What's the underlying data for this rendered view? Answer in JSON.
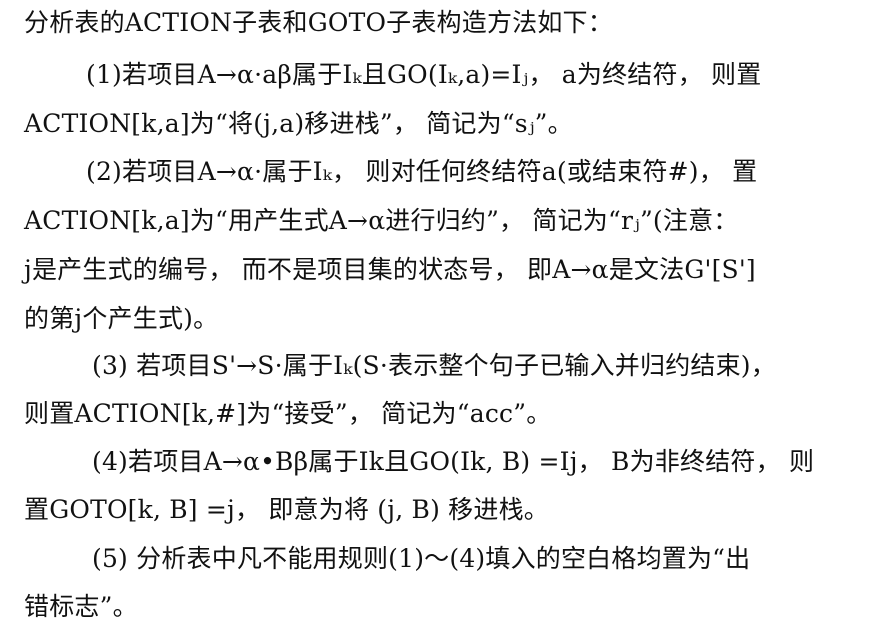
{
  "document": {
    "lines": [
      "分析表的ACTION子表和GOTO子表构造方法如下：",
      "(1)若项目A→α·aβ属于Iₖ且GO(Iₖ,a)=Iⱼ， a为终结符， 则置",
      "ACTION[k,a]为“将(j,a)移进栈”， 简记为“sⱼ”。",
      "(2)若项目A→α·属于Iₖ， 则对任何终结符a(或结束符#)， 置",
      "ACTION[k,a]为“用产生式A→α进行归约”， 简记为“rⱼ”(注意：",
      "j是产生式的编号， 而不是项目集的状态号， 即A→α是文法G'[S']",
      "的第j个产生式)。",
      "(3) 若项目S'→S·属于Iₖ(S·表示整个句子已输入并归约结束)，",
      "则置ACTION[k,#]为“接受”， 简记为“acc”。",
      "(4)若项目A→α•Bβ属于Ik且GO(Ik, B) =Ij， B为非终结符， 则",
      "置GOTO[k, B] =j， 即意为将 (j, B) 移进栈。",
      "(5) 分析表中凡不能用规则(1)～(4)填入的空白格均置为“出",
      "错标志”。"
    ]
  }
}
